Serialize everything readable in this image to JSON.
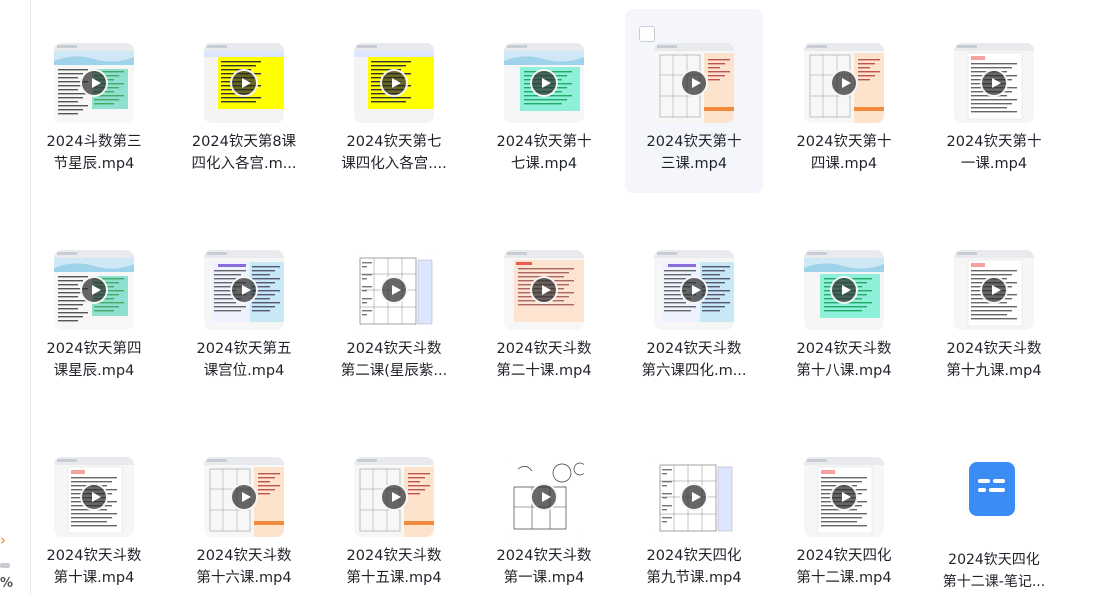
{
  "sidebar": {
    "pct_label": "%",
    "chevron": "chevron-right-icon"
  },
  "files": [
    {
      "name": "2024斗数第三\n节星辰.mp4",
      "type": "video",
      "theme": "sky"
    },
    {
      "name": "2024钦天第8课\n四化入各宫.m...",
      "type": "video",
      "theme": "yellow"
    },
    {
      "name": "2024钦天第七\n课四化入各宫....",
      "type": "video",
      "theme": "yellow"
    },
    {
      "name": "2024钦天第十\n七课.mp4",
      "type": "video",
      "theme": "mint"
    },
    {
      "name": "2024钦天第十\n三课.mp4",
      "type": "video",
      "theme": "chart-peach",
      "selected": true
    },
    {
      "name": "2024钦天第十\n四课.mp4",
      "type": "video",
      "theme": "chart-peach"
    },
    {
      "name": "2024钦天第十\n一课.mp4",
      "type": "video",
      "theme": "doc"
    },
    {
      "name": "2024钦天第四\n课星辰.mp4",
      "type": "video",
      "theme": "sky"
    },
    {
      "name": "2024钦天第五\n课宫位.mp4",
      "type": "video",
      "theme": "blue-split"
    },
    {
      "name": "2024钦天斗数\n第二课(星辰紫...",
      "type": "video",
      "theme": "grid"
    },
    {
      "name": "2024钦天斗数\n第二十课.mp4",
      "type": "video",
      "theme": "peach"
    },
    {
      "name": "2024钦天斗数\n第六课四化.m...",
      "type": "video",
      "theme": "blue-split"
    },
    {
      "name": "2024钦天斗数\n第十八课.mp4",
      "type": "video",
      "theme": "mint"
    },
    {
      "name": "2024钦天斗数\n第十九课.mp4",
      "type": "video",
      "theme": "doc"
    },
    {
      "name": "2024钦天斗数\n第十课.mp4",
      "type": "video",
      "theme": "doc"
    },
    {
      "name": "2024钦天斗数\n第十六课.mp4",
      "type": "video",
      "theme": "chart-peach"
    },
    {
      "name": "2024钦天斗数\n第十五课.mp4",
      "type": "video",
      "theme": "chart-peach"
    },
    {
      "name": "2024钦天斗数\n第一课.mp4",
      "type": "video",
      "theme": "sketch"
    },
    {
      "name": "2024钦天四化\n第九节课.mp4",
      "type": "video",
      "theme": "grid"
    },
    {
      "name": "2024钦天四化\n第十二课.mp4",
      "type": "video",
      "theme": "doc"
    },
    {
      "name": "2024钦天四化\n第十二课-笔记...",
      "type": "doc",
      "theme": "doc-icon"
    }
  ],
  "colors": {
    "selected_bg": "#f4f6fb",
    "doc_icon": "#3b8cf5",
    "accent_orange": "#f08a24"
  }
}
